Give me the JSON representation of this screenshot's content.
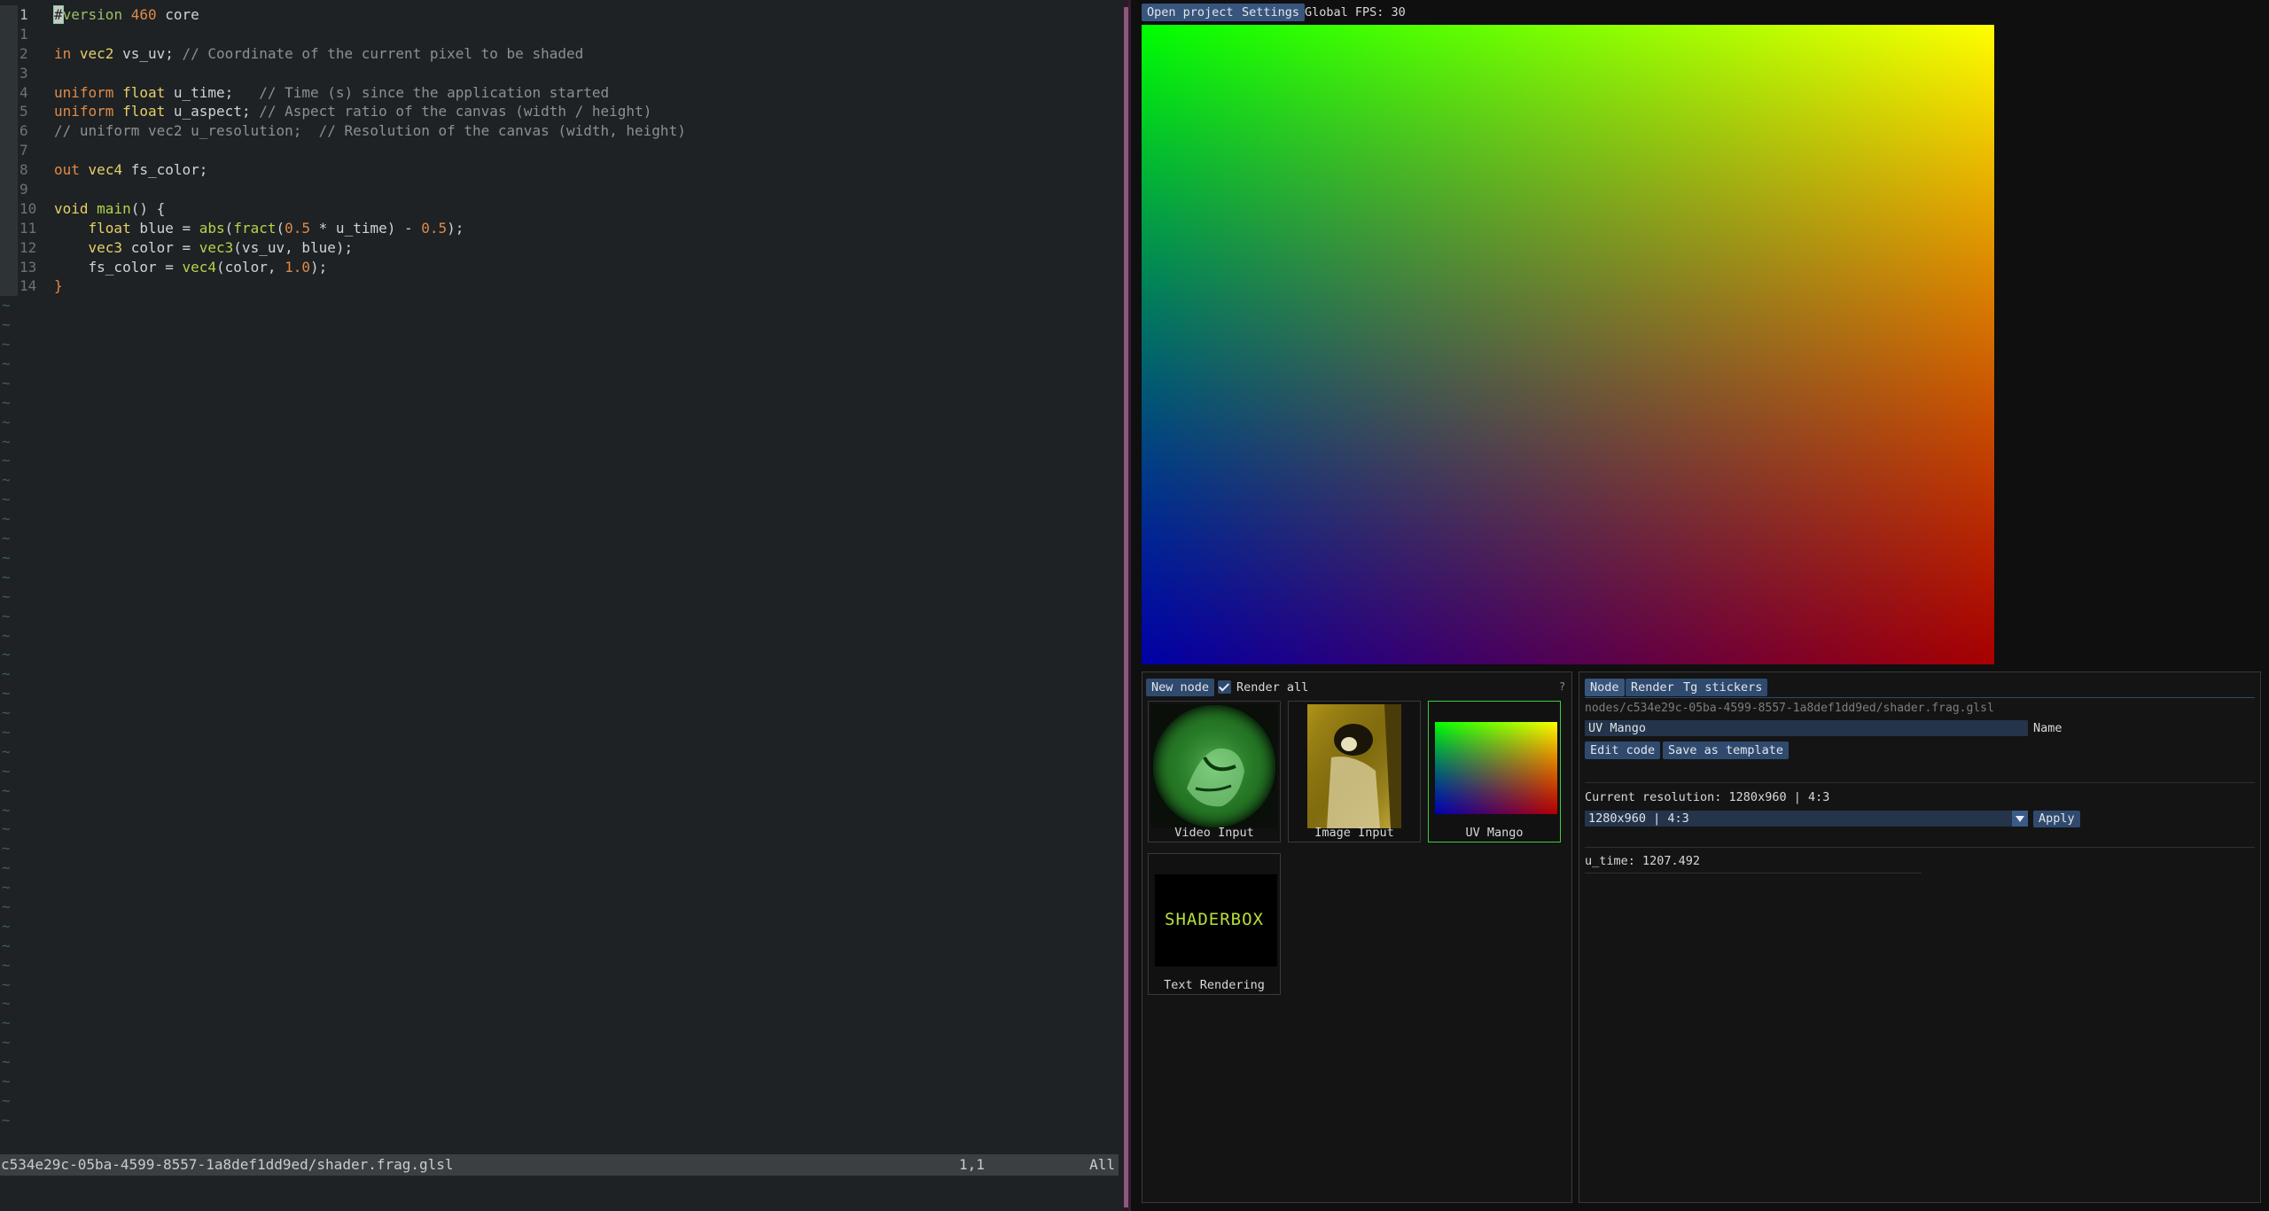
{
  "editor": {
    "lines": [
      {
        "n": "1",
        "html": "<span class=\"cursor\">#</span><span class=\"pp\">version</span> <span class=\"num\">460</span> core"
      },
      {
        "n": "1",
        "html": ""
      },
      {
        "n": "2",
        "html": "<span class=\"kw\">in</span> <span class=\"ty\">vec2</span> vs_uv; <span class=\"cm\">// Coordinate of the current pixel to be shaded</span>"
      },
      {
        "n": "3",
        "html": ""
      },
      {
        "n": "4",
        "html": "<span class=\"kw\">uniform</span> <span class=\"ty\">float</span> u_time;   <span class=\"cm\">// Time (s) since the application started</span>"
      },
      {
        "n": "5",
        "html": "<span class=\"kw\">uniform</span> <span class=\"ty\">float</span> u_aspect; <span class=\"cm\">// Aspect ratio of the canvas (width / height)</span>"
      },
      {
        "n": "6",
        "html": "<span class=\"cm\">// uniform vec2 u_resolution;  // Resolution of the canvas (width, height)</span>"
      },
      {
        "n": "7",
        "html": ""
      },
      {
        "n": "8",
        "html": "<span class=\"kw\">out</span> <span class=\"ty\">vec4</span> fs_color;"
      },
      {
        "n": "9",
        "html": ""
      },
      {
        "n": "10",
        "html": "<span class=\"ty\">void</span> <span class=\"fn\">main</span>() {"
      },
      {
        "n": "11",
        "html": "    <span class=\"ty\">float</span> blue = <span class=\"fn\">abs</span>(<span class=\"fn\">fract</span>(<span class=\"num\">0.5</span> * u_time) - <span class=\"num\">0.5</span>);"
      },
      {
        "n": "12",
        "html": "    <span class=\"ty\">vec3</span> color = <span class=\"fn\">vec3</span>(vs_uv, blue);"
      },
      {
        "n": "13",
        "html": "    fs_color = <span class=\"fn\">vec4</span>(color, <span class=\"num\">1.0</span>);"
      },
      {
        "n": "14",
        "html": "<span class=\"kw\">}</span>"
      }
    ],
    "tilde": "~",
    "status_path": "c534e29c-05ba-4599-8557-1a8def1dd9ed/shader.frag.glsl",
    "status_pos": "1,1",
    "status_all": "All"
  },
  "topbar": {
    "open_project": "Open project",
    "settings": "Settings",
    "fps": "Global FPS: 30"
  },
  "nodes": {
    "new_node": "New node",
    "render_all": "Render all",
    "help": "?",
    "items": [
      {
        "label": "Video Input"
      },
      {
        "label": "Image Input"
      },
      {
        "label": "UV Mango"
      },
      {
        "label": "Text Rendering",
        "thumb_text": "SHADERBOX"
      }
    ]
  },
  "props": {
    "tabs": [
      "Node",
      "Render",
      "Tg stickers"
    ],
    "path": "nodes/c534e29c-05ba-4599-8557-1a8def1dd9ed/shader.frag.glsl",
    "name_value": "UV Mango",
    "name_label": "Name",
    "edit_code": "Edit code",
    "save_template": "Save as template",
    "current_resolution": "Current resolution: 1280x960 | 4:3",
    "resolution_select": "1280x960 | 4:3",
    "apply": "Apply",
    "u_time": "u_time: 1207.492"
  },
  "colors": {
    "accent_blue": "#2f4a6e",
    "selected_node_border": "#3ccf3c",
    "editor_bg": "#1e2224"
  }
}
